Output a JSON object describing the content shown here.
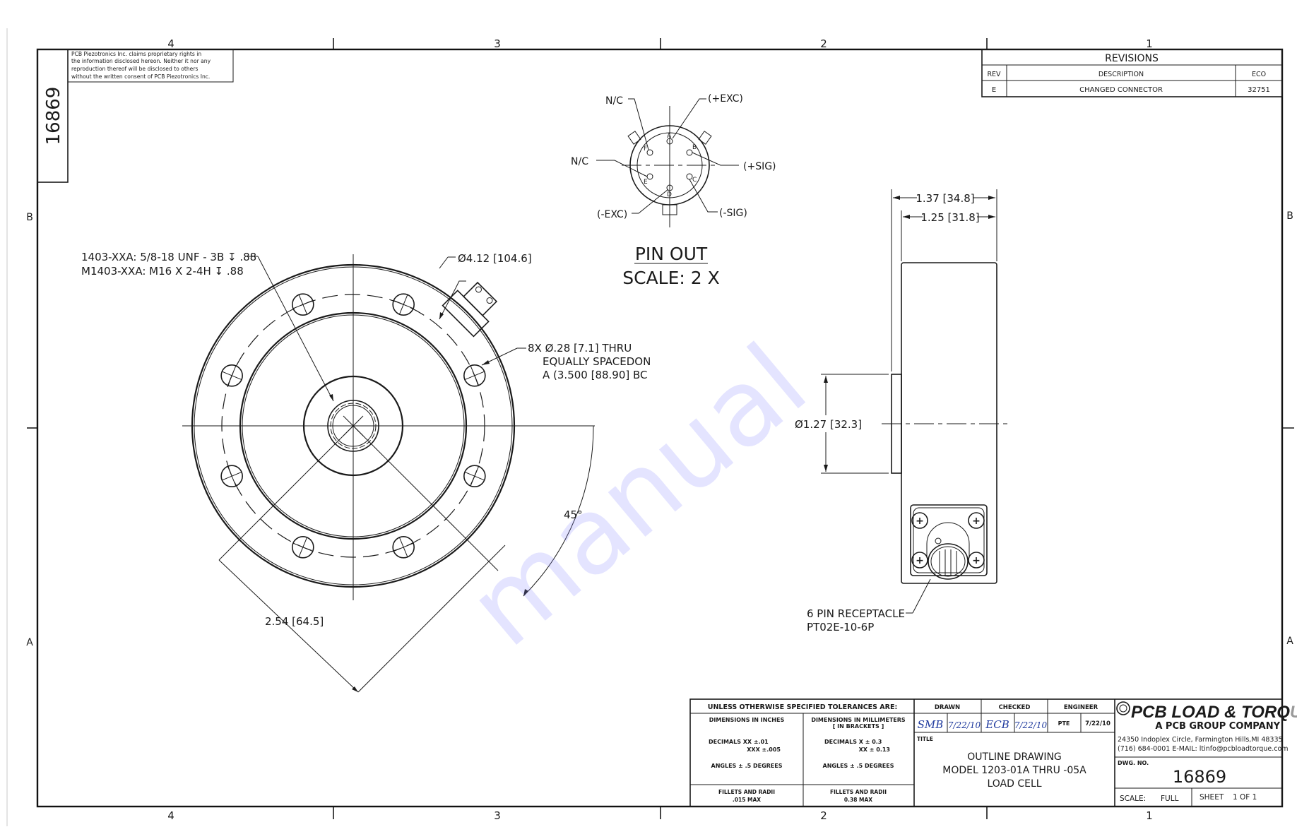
{
  "sheet": {
    "zones_top": [
      "4",
      "3",
      "2",
      "1"
    ],
    "zones_bottom": [
      "4",
      "3",
      "2",
      "1"
    ],
    "zones_left": [
      "B",
      "A"
    ],
    "zones_right": [
      "B",
      "A"
    ],
    "side_dwg_no": "16869",
    "proprietary_notice": [
      "PCB Piezotronics Inc. claims proprietary rights in",
      "the information disclosed hereon.  Neither it nor any",
      "reproduction thereof will be disclosed to others",
      "without the written consent of PCB Piezotronics Inc."
    ],
    "watermark": "manual"
  },
  "revisions": {
    "title": "REVISIONS",
    "headers": [
      "REV",
      "DESCRIPTION",
      "ECO"
    ],
    "rows": [
      {
        "rev": "E",
        "description": "CHANGED CONNECTOR",
        "eco": "32751"
      }
    ]
  },
  "pinout": {
    "title": "PIN OUT",
    "scale": "SCALE: 2 X",
    "pins": [
      "A",
      "B",
      "C",
      "D",
      "E",
      "F"
    ],
    "callouts": {
      "a": "(+EXC)",
      "b": "(+SIG)",
      "c": "(-SIG)",
      "d": "(-EXC)",
      "e": "N/C",
      "f": "N/C"
    }
  },
  "top_view": {
    "thread_note": [
      "1403-XXA: 5/8-18 UNF - 3B ↧ .88",
      "M1403-XXA: M16 X 2-4H ↧ .88"
    ],
    "outer_dia": "Ø4.12 [104.6]",
    "hole_note": [
      "8X Ø.28 [7.1] THRU",
      "EQUALLY SPACEDON",
      "A (3.500 [88.90] BC"
    ],
    "angle": "45°",
    "radial_dim": "2.54 [64.5]"
  },
  "side_view": {
    "overall_width": "1.37 [34.8]",
    "body_width": "1.25 [31.8]",
    "boss_dia": "Ø1.27 [32.3]",
    "connector_note": [
      "6 PIN RECEPTACLE",
      "PT02E-10-6P"
    ]
  },
  "title_block": {
    "tolerances_header": "UNLESS OTHERWISE SPECIFIED TOLERANCES ARE:",
    "inch_header": "DIMENSIONS  IN INCHES",
    "mm_header": [
      "DIMENSIONS IN MILLIMETERS",
      "[ IN BRACKETS ]"
    ],
    "inch_decimals": [
      "DECIMALS    XX  ±.01",
      "XXX  ±.005"
    ],
    "mm_decimals": [
      "DECIMALS   X  ± 0.3",
      "XX  ± 0.13"
    ],
    "inch_angles": "ANGLES  ±  .5 DEGREES",
    "mm_angles": "ANGLES  ±  .5 DEGREES",
    "inch_fillets": [
      "FILLETS AND RADII",
      ".015 MAX"
    ],
    "mm_fillets": [
      "FILLETS AND RADII",
      "0.38 MAX"
    ],
    "drawn_label": "DRAWN",
    "checked_label": "CHECKED",
    "engineer_label": "ENGINEER",
    "drawn_by": "SMB",
    "drawn_date": "7/22/10",
    "checked_by": "ECB",
    "checked_date": "7/22/10",
    "engineer_by": "PTE",
    "engineer_date": "7/22/10",
    "title_label": "TITLE",
    "title_lines": [
      "OUTLINE DRAWING",
      "MODEL 1203-01A THRU -05A",
      "LOAD CELL"
    ],
    "company_name_main": "PCB LOAD & TORQ",
    "company_name_tail": "UE",
    "company_sub": "A PCB GROUP COMPANY",
    "address": "24350 Indoplex Circle, Farmington Hills,MI 48335",
    "contact": "(716)  684-0001 E-MAIL:  ltinfo@pcbloadtorque.com",
    "dwg_no_label": "DWG. NO.",
    "dwg_no": "16869",
    "scale_label": "SCALE:",
    "scale_value": "FULL",
    "sheet_label": "SHEET",
    "sheet_value": "1  OF  1"
  }
}
